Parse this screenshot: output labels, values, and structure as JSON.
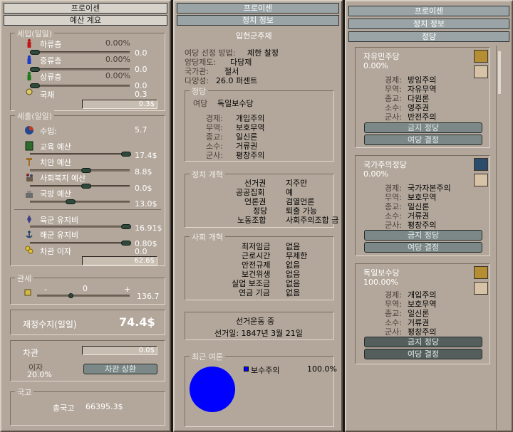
{
  "left": {
    "title": "프로이센",
    "tab": "예산 계요",
    "income": {
      "legend": "세입(일일)",
      "rows": [
        {
          "label": "하류층",
          "pct": "0.00%",
          "val": "0.0"
        },
        {
          "label": "중류층",
          "pct": "0.00%",
          "val": "0.0"
        },
        {
          "label": "상류층",
          "pct": "0.00%",
          "val": "0.0"
        }
      ],
      "debt_label": "국채",
      "debt_val": "0.3",
      "total": "0.3$"
    },
    "expense": {
      "legend": "세출(일일)",
      "income_label": "수입:",
      "income_val": "5.7",
      "rows": [
        {
          "label": "교육 예산",
          "val": "17.4$"
        },
        {
          "label": "치안 예산",
          "val": "8.8$"
        },
        {
          "label": "사회복지 예산",
          "val": "0.0$"
        },
        {
          "label": "국방 예산",
          "val": "13.0$"
        }
      ],
      "army_label": "육군 유지비",
      "army_val": "16.91$",
      "navy_label": "해군 유지비",
      "navy_val": "0.80$",
      "interest_label": "차관 이자",
      "interest_val": "0.0",
      "total": "62.6$"
    },
    "tariff": {
      "legend": "관세",
      "minus": "-",
      "plus": "+",
      "center": "0",
      "val": "136.7"
    },
    "balance_label": "재정수지(일일)",
    "balance_val": "74.4$",
    "loan": {
      "label": "차관",
      "val": "0.0$",
      "interest_label": "이자",
      "interest_val": "20.0%",
      "button": "차관 상환"
    },
    "treasury": {
      "legend": "국고",
      "label": "총국고",
      "val": "66395.3$"
    }
  },
  "middle": {
    "title": "프로이센",
    "tab": "정치 정보",
    "government": "입헌군주제",
    "info": [
      {
        "label": "여당 선정 방법:",
        "value": "제한 찰정"
      },
      {
        "label": "양당제도:",
        "value": "다당제"
      },
      {
        "label": "국가관:",
        "value": "절서"
      },
      {
        "label": "다양성:",
        "value": "26.0 퍼센트"
      }
    ],
    "party_legend": "정당",
    "ruling_label": "여당",
    "ruling_name": "독일보수당",
    "ruling_policies": [
      {
        "k": "경제:",
        "v": "개입주의"
      },
      {
        "k": "무역:",
        "v": "보호무역"
      },
      {
        "k": "종교:",
        "v": "일신론"
      },
      {
        "k": "소수:",
        "v": "거류권"
      },
      {
        "k": "군사:",
        "v": "평창주의"
      }
    ],
    "political_legend": "정치 개혁",
    "political": [
      {
        "k": "선거권",
        "v": "지주만"
      },
      {
        "k": "공공집회",
        "v": "예"
      },
      {
        "k": "언론권",
        "v": "검열언론"
      },
      {
        "k": "정당",
        "v": "퇴출 가능"
      },
      {
        "k": "노동조합",
        "v": "사회주의조합 금"
      }
    ],
    "social_legend": "사회 개혁",
    "social": [
      {
        "k": "최저임금",
        "v": "없음"
      },
      {
        "k": "근로시간",
        "v": "무제한"
      },
      {
        "k": "안전규제",
        "v": "없음"
      },
      {
        "k": "보건위생",
        "v": "없음"
      },
      {
        "k": "실업 보조금",
        "v": "없음"
      },
      {
        "k": "연금 기금",
        "v": "없음"
      }
    ],
    "election_status": "선거운동 중",
    "election_date": "선거일: 1847년 3월 21일",
    "poll_legend": "최근 여론",
    "poll": {
      "name": "보수주의",
      "value": "100.0%",
      "color": "#0000ff"
    }
  },
  "right": {
    "title": "프로이센",
    "tab1": "정치 정보",
    "tab2": "정당",
    "parties": [
      {
        "name": "자유민주당",
        "pct": "0.00%",
        "policies": [
          {
            "k": "경제:",
            "v": "방임주의"
          },
          {
            "k": "무역:",
            "v": "자유무역"
          },
          {
            "k": "종교:",
            "v": "다원론"
          },
          {
            "k": "소수:",
            "v": "영주권"
          },
          {
            "k": "군사:",
            "v": "반전주의"
          }
        ],
        "btn1": "금지 정당",
        "btn2": "여당 결정"
      },
      {
        "name": "국가주의정당",
        "pct": "0.00%",
        "policies": [
          {
            "k": "경제:",
            "v": "국가자본주의"
          },
          {
            "k": "무역:",
            "v": "보호무역"
          },
          {
            "k": "종교:",
            "v": "일신론"
          },
          {
            "k": "소수:",
            "v": "거류권"
          },
          {
            "k": "군사:",
            "v": "평창주의"
          }
        ],
        "btn1": "금지 정당",
        "btn2": "여당 결정"
      },
      {
        "name": "독일보수당",
        "pct": "100.00%",
        "policies": [
          {
            "k": "경제:",
            "v": "개입주의"
          },
          {
            "k": "무역:",
            "v": "보호무역"
          },
          {
            "k": "종교:",
            "v": "일신론"
          },
          {
            "k": "소수:",
            "v": "거류권"
          },
          {
            "k": "군사:",
            "v": "평창주의"
          }
        ],
        "btn1": "금지 정당",
        "btn2": "여당 결정"
      }
    ]
  }
}
